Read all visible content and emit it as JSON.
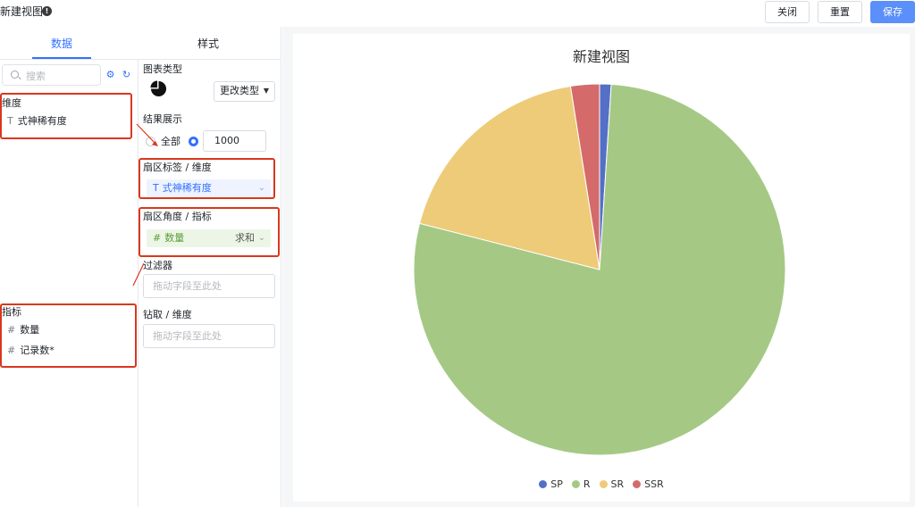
{
  "header": {
    "title": "新建视图",
    "close_label": "关闭",
    "reset_label": "重置",
    "save_label": "保存"
  },
  "tabs": [
    {
      "label": "数据",
      "active": true
    },
    {
      "label": "样式",
      "active": false
    }
  ],
  "data_pane": {
    "search_placeholder": "搜索",
    "dimension_label": "维度",
    "dimensions": [
      {
        "icon": "T",
        "label": "式神稀有度"
      }
    ],
    "measure_label": "指标",
    "measures": [
      {
        "icon": "#",
        "label": "数量"
      },
      {
        "icon": "#",
        "label": "记录数*"
      }
    ]
  },
  "config_pane": {
    "chart_type_label": "图表类型",
    "change_type_label": "更改类型",
    "result_label": "结果展示",
    "result_all_label": "全部",
    "result_count": "1000",
    "sector_label_title": "扇区标签 / 维度",
    "sector_label_field": "式神稀有度",
    "sector_label_icon": "T",
    "sector_angle_title": "扇区角度 / 指标",
    "sector_angle_field": "数量",
    "sector_angle_icon": "#",
    "sector_angle_agg": "求和",
    "filter_title": "过滤器",
    "filter_placeholder": "拖动字段至此处",
    "drill_title": "钻取 / 维度",
    "drill_placeholder": "拖动字段至此处"
  },
  "colors": {
    "accent": "#3370ff",
    "save": "#5b8ff9",
    "highlight_box": "#d9381e"
  },
  "chart_data": {
    "type": "pie",
    "title": "新建视图",
    "categories": [
      "SP",
      "R",
      "SR",
      "SSR"
    ],
    "values": [
      1,
      78,
      18.5,
      2.5
    ],
    "colors": [
      "#5470c6",
      "#a5c985",
      "#eecb78",
      "#d46a6a"
    ],
    "legend_position": "bottom"
  }
}
